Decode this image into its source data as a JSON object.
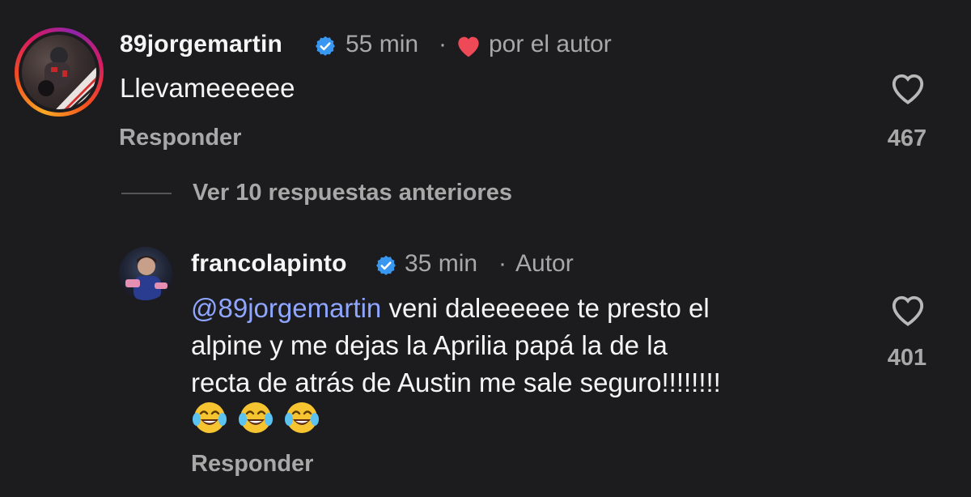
{
  "comment": {
    "username": "89jorgemartin",
    "time": "55 min",
    "separator": "·",
    "liked_by_author_label": "por el autor",
    "text": "Llevameeeeee",
    "reply_label": "Responder",
    "like_count": "467"
  },
  "view_replies": {
    "label": "Ver 10 respuestas anteriores"
  },
  "reply_comment": {
    "username": "francolapinto",
    "time": "35 min",
    "separator": "·",
    "author_badge": "Autor",
    "mention": "@89jorgemartin",
    "text_line1_rest": " veni daleeeeee te presto el",
    "text_line2": "alpine y me dejas la Aprilia papá la de la",
    "text_line3": "recta de atrás de Austin me sale seguro!!!!!!!!",
    "emojis": [
      "😂",
      "😂",
      "😂"
    ],
    "reply_label": "Responder",
    "like_count": "401"
  },
  "colors": {
    "background": "#1c1c1e",
    "primary_text": "#f5f5f5",
    "secondary_text": "#a8a8a8",
    "mention": "#8ea6ff",
    "verified": "#3897f0",
    "heart": "#ed4956"
  }
}
